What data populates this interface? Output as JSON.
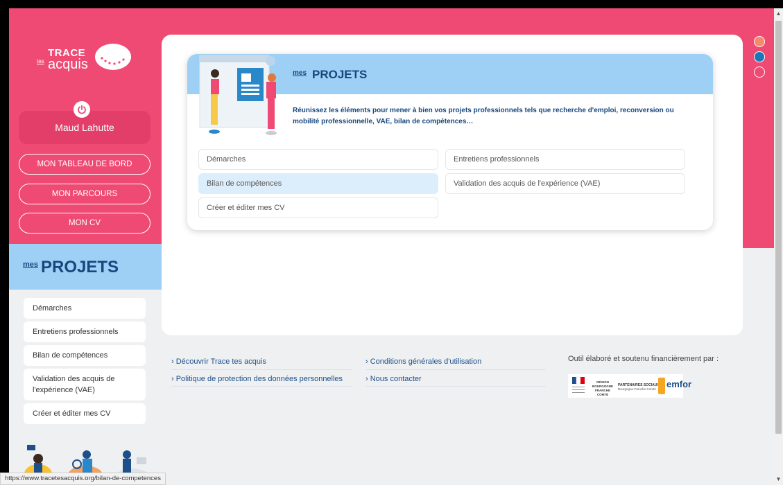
{
  "logo": {
    "trace": "TRACE",
    "tes": "tes",
    "acquis": "acquis"
  },
  "user": {
    "name": "Maud Lahutte"
  },
  "nav": [
    {
      "label": "MON TABLEAU DE BORD"
    },
    {
      "label": "MON PARCOURS"
    },
    {
      "label": "MON CV"
    }
  ],
  "sidebar_section": {
    "mes": "mes",
    "title": "PROJETS"
  },
  "sidebar_items": [
    {
      "label": "Démarches"
    },
    {
      "label": "Entretiens professionnels"
    },
    {
      "label": "Bilan de compétences"
    },
    {
      "label": "Validation des acquis de l'expérience (VAE)"
    },
    {
      "label": "Créer et éditer mes CV"
    }
  ],
  "projects": {
    "mes": "mes",
    "title": "PROJETS",
    "description": "Réunissez les éléments pour mener à bien vos projets professionnels tels que recherche d'emploi, reconversion ou mobilité professionnelle, VAE, bilan de compétences…",
    "items": [
      {
        "label": "Démarches",
        "active": false
      },
      {
        "label": "Entretiens professionnels",
        "active": false
      },
      {
        "label": "Bilan de compétences",
        "active": true
      },
      {
        "label": "Validation des acquis de l'expérience (VAE)",
        "active": false
      },
      {
        "label": "Créer et éditer mes CV",
        "active": false
      }
    ]
  },
  "footer": {
    "links": [
      {
        "label": "› Découvrir Trace tes acquis"
      },
      {
        "label": "› Conditions générales d'utilisation"
      },
      {
        "label": "› Politique de protection des données personnelles"
      },
      {
        "label": "› Nous contacter"
      }
    ],
    "partners_title": "Outil élaboré et soutenu financièrement par :",
    "partners": {
      "region": "RÉGION BOURGOGNE FRANCHE COMTÉ",
      "social": "PARTENAIRES SOCIAUX",
      "social_sub": "Bourgogne-Franche-Comté",
      "emfor": "emfor"
    }
  },
  "status_url": "https://www.tracetesacquis.org/bilan-de-competences",
  "colors": {
    "brand_pink": "#ef4a74",
    "brand_blue": "#16477f",
    "light_blue": "#9dd0f4",
    "dot_orange": "#f48a6b",
    "dot_blue": "#1a78b8"
  }
}
